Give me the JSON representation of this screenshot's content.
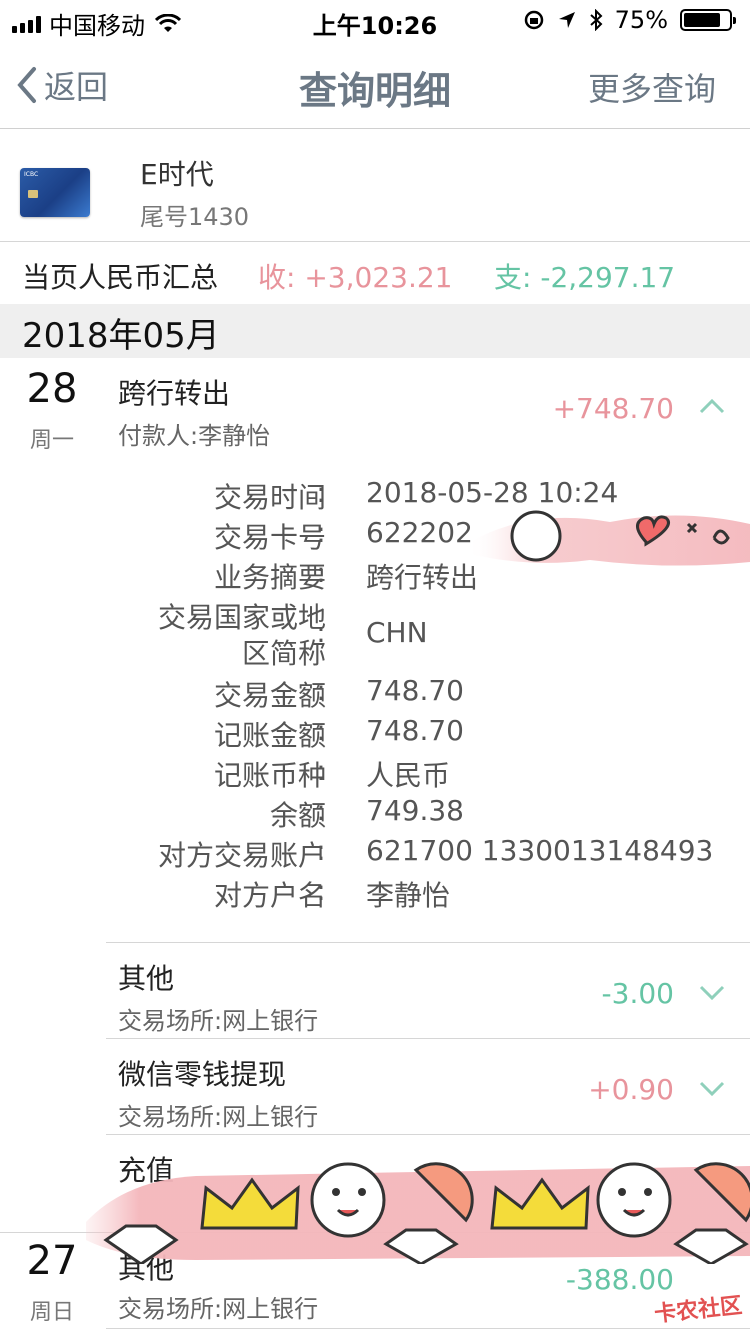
{
  "status_bar": {
    "carrier": "中国移动",
    "time": "上午10:26",
    "battery": "75%",
    "battery_level": 0.75
  },
  "nav": {
    "back_label": "返回",
    "title": "查询明细",
    "more_label": "更多查询"
  },
  "card": {
    "name": "E时代",
    "tail": "尾号1430",
    "bank_mark": "ICBC"
  },
  "summary": {
    "label": "当页人民币汇总",
    "income": "收: +3,023.21",
    "expense": "支: -2,297.17"
  },
  "month": "2018年05月",
  "days": [
    {
      "day": "28",
      "weekday": "周一",
      "transactions": [
        {
          "title": "跨行转出",
          "sub": "付款人:李静怡",
          "amount": "+748.70",
          "expanded": true,
          "details": [
            {
              "label": "交易时间",
              "value": "2018-05-28 10:24"
            },
            {
              "label": "交易卡号",
              "value": "622202"
            },
            {
              "label": "业务摘要",
              "value": "跨行转出"
            },
            {
              "label": "交易国家或地区简称",
              "label_line1": "交易国家或地",
              "label_line2": "区简称",
              "value": "CHN"
            },
            {
              "label": "交易金额",
              "value": "748.70"
            },
            {
              "label": "记账金额",
              "value": "748.70"
            },
            {
              "label": "记账币种",
              "value": "人民币"
            },
            {
              "label": "余额",
              "value": "749.38"
            },
            {
              "label": "对方交易账户",
              "value": "621700 1330013148493"
            },
            {
              "label": "对方户名",
              "value": "李静怡"
            }
          ]
        },
        {
          "title": "其他",
          "sub": "交易场所:网上银行",
          "amount": "-3.00",
          "expanded": false
        },
        {
          "title": "微信零钱提现",
          "sub": "交易场所:网上银行",
          "amount": "+0.90",
          "expanded": false
        },
        {
          "title": "充值",
          "expanded": false
        }
      ]
    },
    {
      "day": "27",
      "weekday": "周日",
      "transactions": [
        {
          "title": "其他",
          "sub": "交易场所:网上银行",
          "amount": "-388.00",
          "expanded": false
        }
      ]
    }
  ],
  "watermark": "卡农社区",
  "colors": {
    "income": "#e8949c",
    "expense": "#65c4a4",
    "nav_text": "#6b7885",
    "month_bg": "#efefef"
  }
}
